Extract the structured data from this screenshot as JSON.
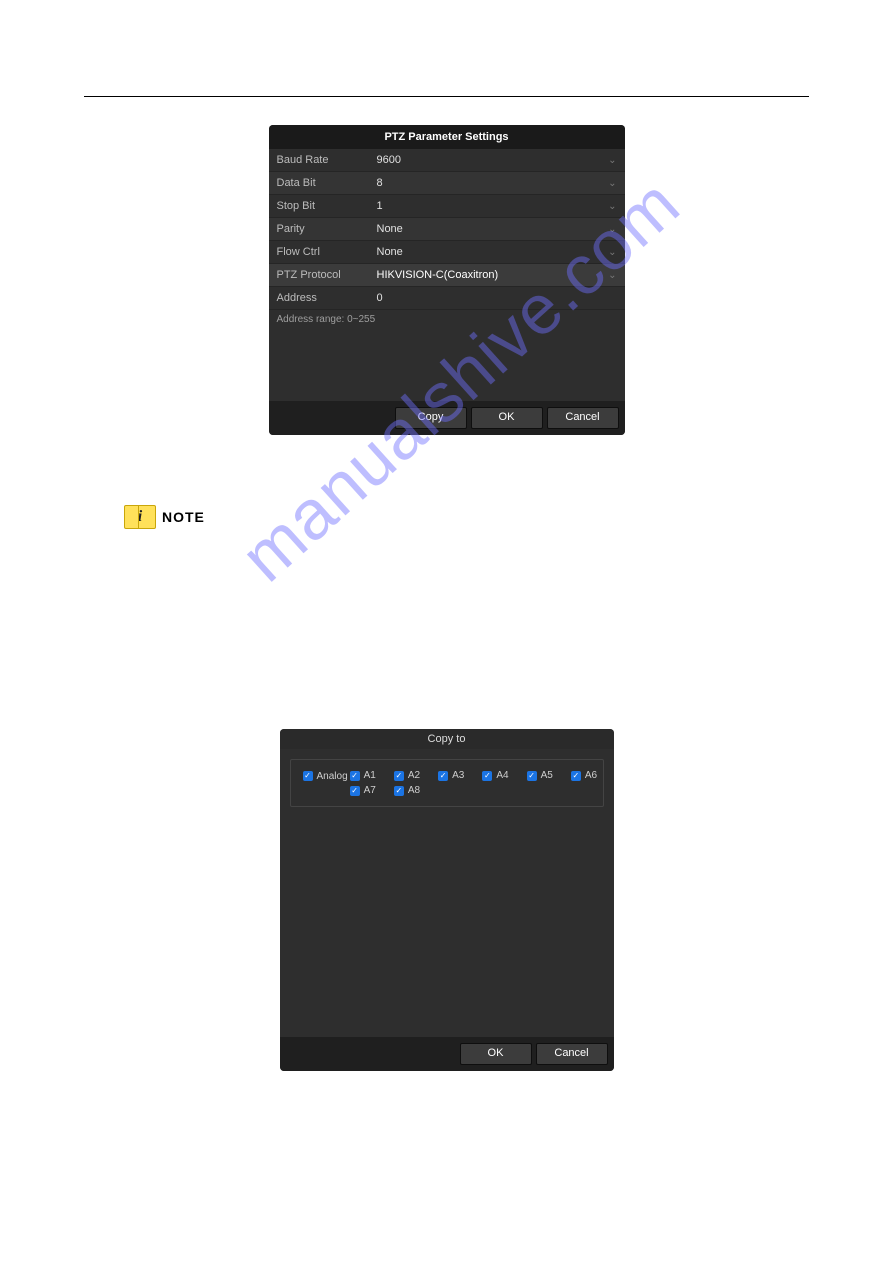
{
  "ptz_dialog": {
    "title": "PTZ Parameter Settings",
    "rows": {
      "baud": {
        "label": "Baud Rate",
        "value": "9600"
      },
      "databit": {
        "label": "Data Bit",
        "value": "8"
      },
      "stopbit": {
        "label": "Stop Bit",
        "value": "1"
      },
      "parity": {
        "label": "Parity",
        "value": "None"
      },
      "flow": {
        "label": "Flow Ctrl",
        "value": "None"
      },
      "proto": {
        "label": "PTZ Protocol",
        "value": "HIKVISION-C(Coaxitron)"
      },
      "addr": {
        "label": "Address",
        "value": "0"
      }
    },
    "address_range": "Address range: 0~255",
    "buttons": {
      "copy": "Copy",
      "ok": "OK",
      "cancel": "Cancel"
    }
  },
  "note": {
    "icon_glyph": "i",
    "label": "NOTE"
  },
  "copyto_dialog": {
    "title": "Copy to",
    "analog_label": "Analog",
    "channels": [
      "A1",
      "A2",
      "A3",
      "A4",
      "A5",
      "A6",
      "A7",
      "A8"
    ],
    "buttons": {
      "ok": "OK",
      "cancel": "Cancel"
    }
  },
  "watermark": "manualshive.com"
}
